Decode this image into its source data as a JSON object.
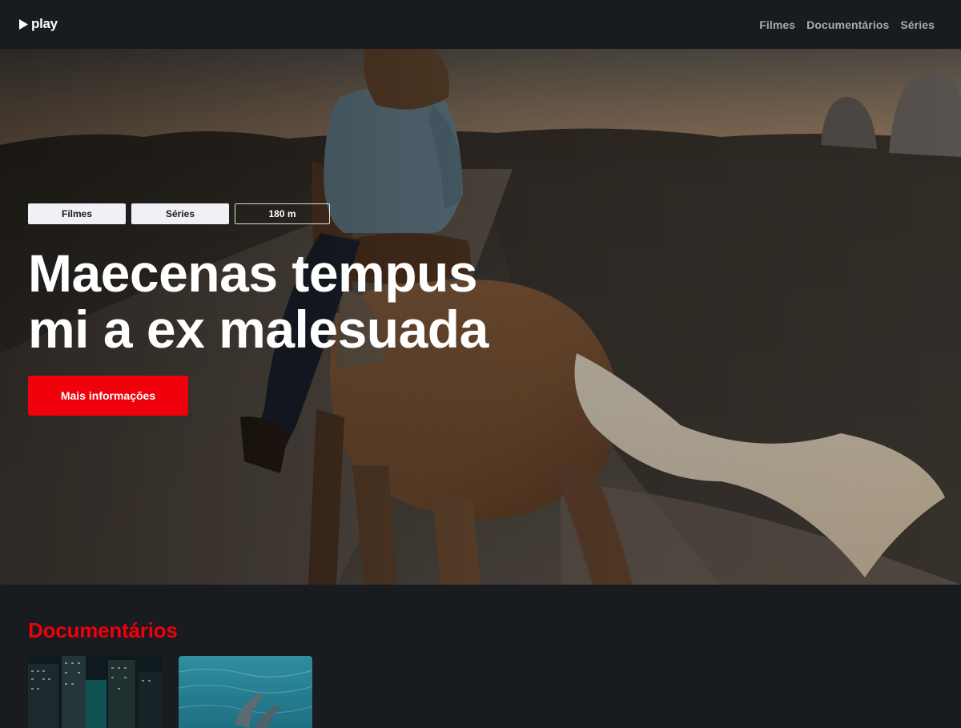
{
  "header": {
    "logo_text": "play",
    "nav": [
      {
        "label": "Filmes"
      },
      {
        "label": "Documentários"
      },
      {
        "label": "Séries"
      }
    ]
  },
  "hero": {
    "tags": [
      "Filmes",
      "Séries",
      "180 m"
    ],
    "title_line1": "Maecenas tempus",
    "title_line2": "mi a ex malesuada",
    "cta_label": "Mais informações",
    "image_icon": "horse-rider-photo"
  },
  "section": {
    "title": "Documentários",
    "cards": [
      {
        "icon": "city-skyscrapers-photo"
      },
      {
        "icon": "dolphins-ocean-photo"
      }
    ]
  },
  "colors": {
    "accent": "#f0000a",
    "background": "#181b1f",
    "nav_text": "#a8aaae",
    "tag_bg": "#eff1f4"
  }
}
